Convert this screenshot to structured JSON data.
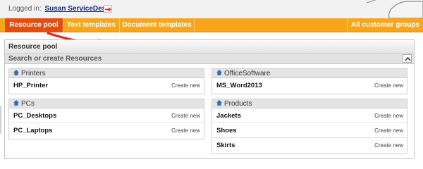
{
  "header": {
    "logged_in_label": "Logged in:",
    "user_name": "Susan ServiceDesk"
  },
  "nav": {
    "tabs": [
      {
        "label": "Resource pool",
        "active": true
      },
      {
        "label": "Text templates",
        "active": false
      },
      {
        "label": "Document templates",
        "active": false
      }
    ],
    "right_tab": "All customer groups"
  },
  "panel": {
    "title": "Resource pool",
    "search_label": "Search or create Resources"
  },
  "groups": [
    {
      "name": "Printers",
      "items": [
        {
          "name": "HP_Printer",
          "action": "Create new"
        }
      ]
    },
    {
      "name": "PCs",
      "items": [
        {
          "name": "PC_Desktops",
          "action": "Create new"
        },
        {
          "name": "PC_Laptops",
          "action": "Create new"
        }
      ]
    },
    {
      "name": "OfficeSoftware",
      "items": [
        {
          "name": "MS_Word2013",
          "action": "Create new"
        }
      ]
    },
    {
      "name": "Products",
      "items": [
        {
          "name": "Jackets",
          "action": "Create new"
        },
        {
          "name": "Shoes",
          "action": "Create new"
        },
        {
          "name": "Skirts",
          "action": "Create new"
        }
      ]
    }
  ],
  "colors": {
    "nav_orange": "#f7a51b",
    "active_tab": "#e44d10",
    "annotation_arrow": "#e8231a",
    "user_link": "#1a2a6c",
    "home_icon": "#2f6db5"
  },
  "icons": {
    "logout": "logout-icon",
    "group": "home-icon",
    "collapse": "chevron-up-icon"
  }
}
